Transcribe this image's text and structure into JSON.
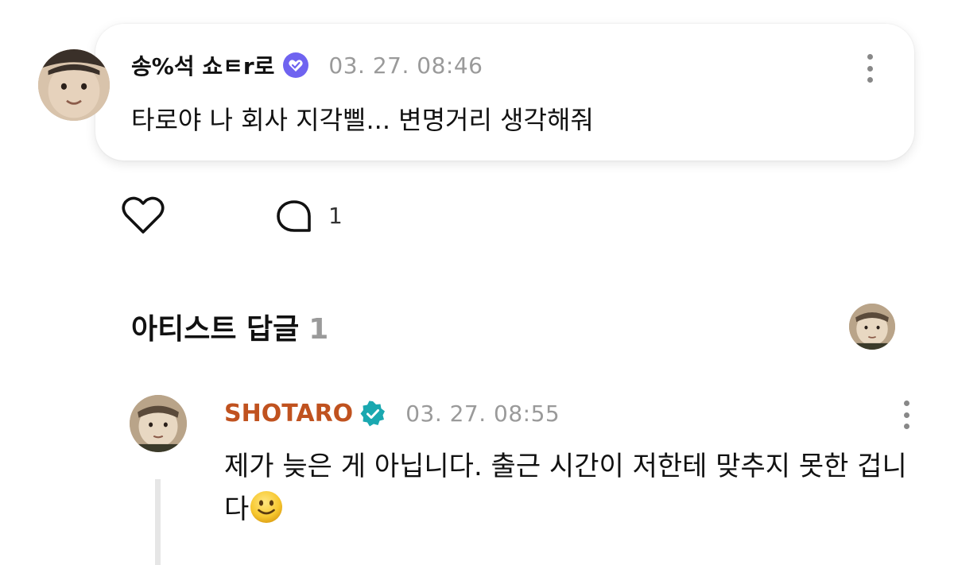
{
  "post": {
    "username": "송%석 쇼ㅌr로",
    "timestamp": "03. 27. 08:46",
    "text": "타로야 나 회사 지각삘... 변명거리 생각해줘",
    "avatar_icon": "face-photo-avatar",
    "verified_icon": "verified-heart-badge-icon",
    "verified_color": "#6f63f0"
  },
  "actions": {
    "comment_count": "1"
  },
  "section": {
    "title": "아티스트 답글",
    "count": "1"
  },
  "reply": {
    "name": "SHOTARO",
    "name_color": "#c0521f",
    "timestamp": "03. 27. 08:55",
    "text": "제가 늦은 게 아닙니다. 출근 시간이 저한테 맞추지 못한 겁니다",
    "emoji": "🙂",
    "verified_icon": "verified-check-badge-icon",
    "verified_color": "#1aa8b0"
  }
}
